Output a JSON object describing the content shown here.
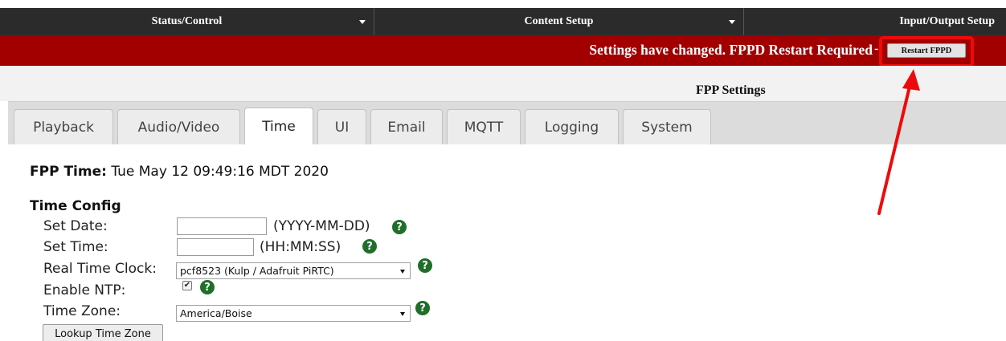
{
  "topnav": {
    "items": [
      {
        "label": "Status/Control"
      },
      {
        "label": "Content Setup"
      },
      {
        "label": "Input/Output Setup"
      }
    ]
  },
  "banner": {
    "message": "Settings have changed. FPPD Restart Required",
    "separator": "-",
    "restart_label": "Restart FPPD",
    "color": "#a20000"
  },
  "page": {
    "title": "FPP Settings"
  },
  "tabs": [
    {
      "label": "Playback",
      "active": false
    },
    {
      "label": "Audio/Video",
      "active": false
    },
    {
      "label": "Time",
      "active": true
    },
    {
      "label": "UI",
      "active": false
    },
    {
      "label": "Email",
      "active": false
    },
    {
      "label": "MQTT",
      "active": false
    },
    {
      "label": "Logging",
      "active": false
    },
    {
      "label": "System",
      "active": false
    }
  ],
  "fpp_time": {
    "label": "FPP Time:",
    "value": "Tue May 12 09:49:16 MDT 2020"
  },
  "time_config": {
    "title": "Time Config",
    "set_date": {
      "label": "Set Date:",
      "value": "",
      "hint": "(YYYY-MM-DD)"
    },
    "set_time": {
      "label": "Set Time:",
      "value": "",
      "hint": "(HH:MM:SS)"
    },
    "rtc": {
      "label": "Real Time Clock:",
      "selected": "pcf8523 (Kulp / Adafruit PiRTC)"
    },
    "ntp": {
      "label": "Enable NTP:",
      "checked": true,
      "check_glyph": "✔"
    },
    "timezone": {
      "label": "Time Zone:",
      "selected": "America/Boise"
    },
    "lookup_label": "Lookup Time Zone"
  },
  "help_glyph": "?",
  "icons": {
    "caret": "chevron-down-icon",
    "help": "help-icon",
    "annotation": "arrow-icon"
  },
  "annotation_color": "#ee0a0a"
}
